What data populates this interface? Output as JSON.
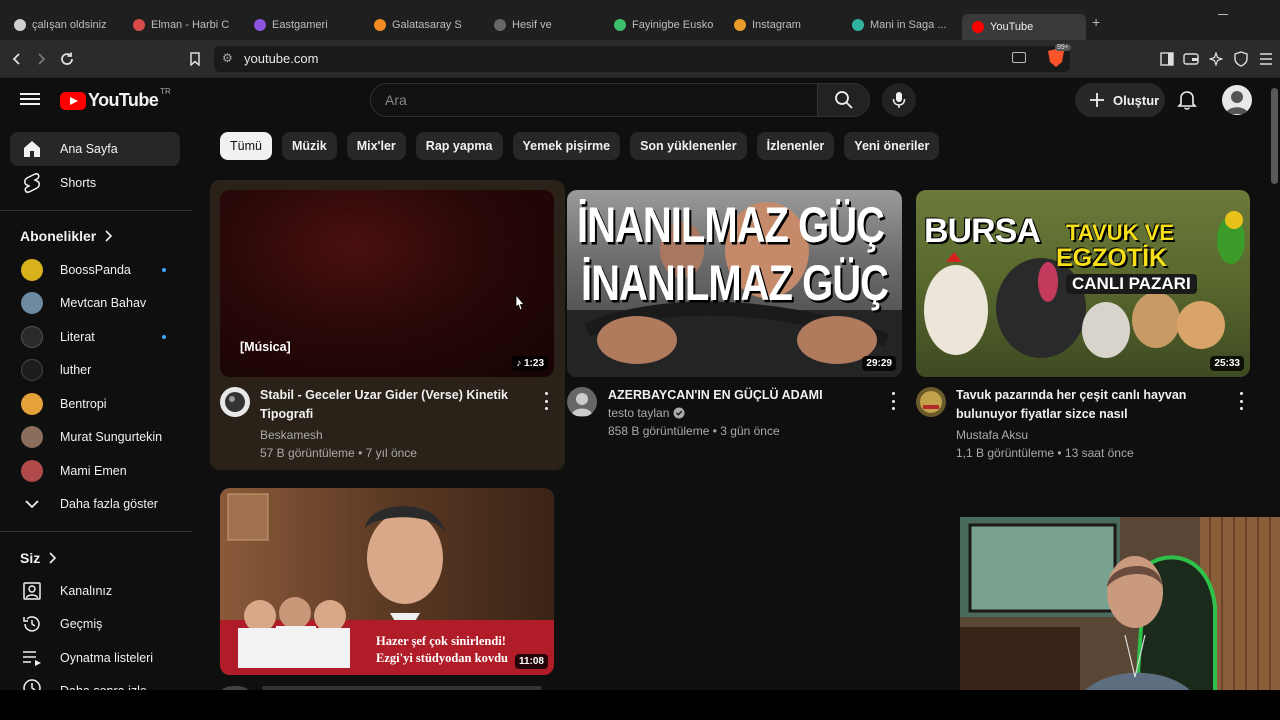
{
  "browser": {
    "tabs": [
      {
        "label": "çalışan oldsiniz",
        "color": "#cfcfcf"
      },
      {
        "label": "Elman - Harbi C",
        "color": "#d94b4b"
      },
      {
        "label": "Eastgameri",
        "color": "#8a54e0"
      },
      {
        "label": "Galatasaray S",
        "color": "#f48b24"
      },
      {
        "label": "Hesif ve",
        "color": "#666666"
      },
      {
        "label": "Fayinigbe Euskon",
        "color": "#3cbf6b"
      },
      {
        "label": "Instagram",
        "color": "#e89a2b"
      },
      {
        "label": "Mani in Saga ...",
        "color": "#2fb3a0"
      },
      {
        "label": "YouTube",
        "color": "#ff0000"
      }
    ],
    "url": "youtube.com",
    "brave_badge": "99+"
  },
  "masthead": {
    "logo_text": "YouTube",
    "region": "TR",
    "search_placeholder": "Ara",
    "create_label": "Oluştur"
  },
  "sidebar": {
    "main": [
      {
        "label": "Ana Sayfa",
        "icon": "home-icon"
      },
      {
        "label": "Shorts",
        "icon": "shorts-icon"
      }
    ],
    "subscriptions_title": "Abonelikler",
    "subscriptions": [
      {
        "label": "BoossPanda",
        "color": "#d8b21c",
        "new": true
      },
      {
        "label": "Mevtcan Bahav",
        "color": "#6e8aa0",
        "new": false
      },
      {
        "label": "Literat",
        "color": "#1a1a1a",
        "new": true
      },
      {
        "label": "luther",
        "color": "#1d1d1d",
        "new": false
      },
      {
        "label": "Bentropi",
        "color": "#e5a23a",
        "new": false
      },
      {
        "label": "Murat Sungurtekin",
        "color": "#8a6d5a",
        "new": false
      },
      {
        "label": "Mami Emen",
        "color": "#b04a4a",
        "new": false
      }
    ],
    "show_more": "Daha fazla göster",
    "you_title": "Siz",
    "you_items": [
      {
        "label": "Kanalınız",
        "icon": "channel-icon"
      },
      {
        "label": "Geçmiş",
        "icon": "history-icon"
      },
      {
        "label": "Oynatma listeleri",
        "icon": "playlist-icon"
      },
      {
        "label": "Daha sonra izle",
        "icon": "watch-later-icon"
      }
    ]
  },
  "chips": [
    "Tümü",
    "Müzik",
    "Mix'ler",
    "Rap yapma",
    "Yemek pişirme",
    "Son yüklenenler",
    "İzlenenler",
    "Yeni öneriler"
  ],
  "videos": [
    {
      "title_line1": "Stabil - Geceler Uzar Gider (Verse) Kinetik",
      "title_line2": "Tipografi",
      "channel": "Beskamesh",
      "stats": "57 B görüntüleme • 7 yıl önce",
      "duration": "1:23",
      "caption": "[Música]"
    },
    {
      "title_line1": "AZERBAYCAN'IN EN GÜÇLÜ ADAMI",
      "title_line2": "",
      "channel": "testo taylan",
      "stats": "858 B görüntüleme • 3 gün önce",
      "duration": "29:29",
      "thumb_text1": "İNANILMAZ GÜÇ",
      "thumb_text2": "İNANILMAZ GÜÇ"
    },
    {
      "title_line1": "Tavuk pazarında her çeşit canlı hayvan",
      "title_line2": "bulunuyor fiyatlar sizce nasıl",
      "channel": "Mustafa Aksu",
      "stats": "1,1 B görüntüleme • 13 saat önce",
      "duration": "25:33",
      "thumb_text1": "BURSA",
      "thumb_text2": "TAVUK VE",
      "thumb_text3": "EGZOTİK",
      "thumb_text4": "CANLI PAZARI"
    },
    {
      "title_line1": "",
      "duration": "11:08",
      "thumb_text1": "Hazer şef çok sinirlendi!",
      "thumb_text2": "Ezgi'yi stüdyodan kovdu"
    }
  ]
}
